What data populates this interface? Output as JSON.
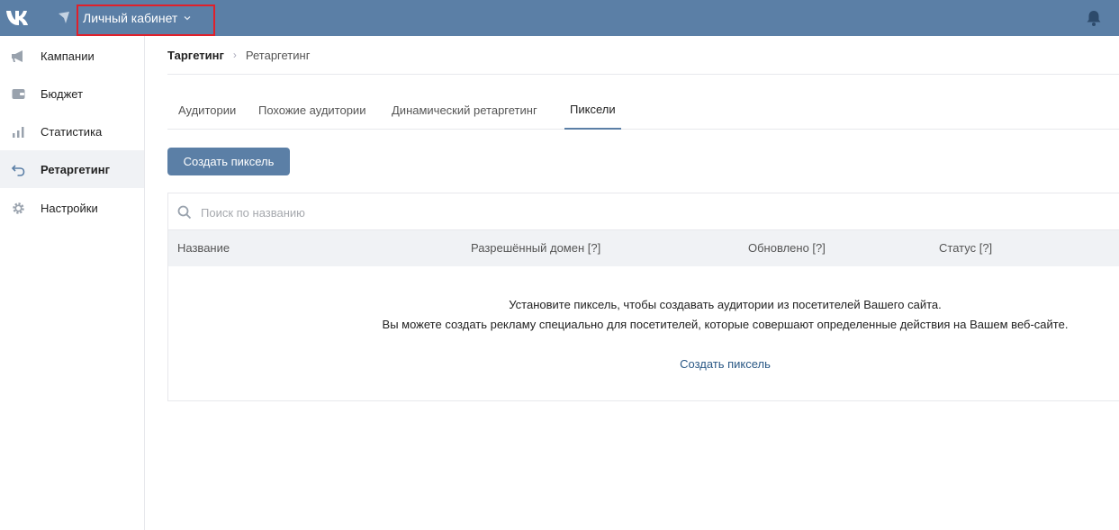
{
  "topbar": {
    "cabinet_label": "Личный кабинет",
    "highlight_color": "#e0202a",
    "bar_color": "#5b7fa6"
  },
  "sidebar": {
    "items": [
      {
        "label": "Кампании",
        "icon": "megaphone-icon"
      },
      {
        "label": "Бюджет",
        "icon": "wallet-icon"
      },
      {
        "label": "Статистика",
        "icon": "bar-chart-icon"
      },
      {
        "label": "Ретаргетинг",
        "icon": "retarget-icon",
        "active": true
      },
      {
        "label": "Настройки",
        "icon": "gear-icon"
      }
    ]
  },
  "breadcrumb": {
    "root": "Таргетинг",
    "separator": "›",
    "current": "Ретаргетинг"
  },
  "tabs": [
    {
      "label": "Аудитории"
    },
    {
      "label": "Похожие аудитории"
    },
    {
      "label": "Динамический ретаргетинг"
    },
    {
      "label": "Пиксели",
      "active": true
    }
  ],
  "create_button": "Создать пиксель",
  "search": {
    "placeholder": "Поиск по названию"
  },
  "table": {
    "columns": [
      "Название",
      "Разрешённый домен [?]",
      "Обновлено [?]",
      "Статус [?]"
    ]
  },
  "empty_state": {
    "line1": "Установите пиксель, чтобы создавать аудитории из посетителей Вашего сайта.",
    "line2": "Вы можете создать рекламу специально для посетителей, которые совершают определенные действия на Вашем веб-сайте.",
    "link": "Создать пиксель"
  }
}
